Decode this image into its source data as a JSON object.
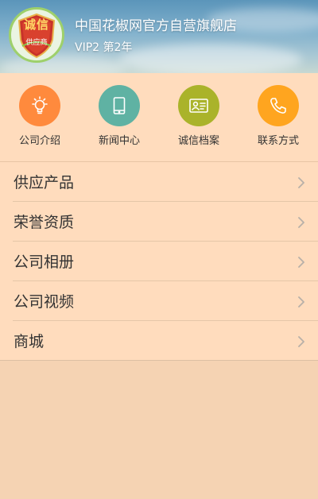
{
  "header": {
    "store_name": "中国花椒网官方自营旗舰店",
    "level": "VIP2 第2年",
    "avatar": {
      "badge_main": "诚信",
      "badge_sub": "供应商"
    }
  },
  "quick_links": [
    {
      "label": "公司介绍",
      "icon": "lightbulb-icon",
      "color": "#ff8a3d"
    },
    {
      "label": "新闻中心",
      "icon": "tablet-icon",
      "color": "#5fb2a3"
    },
    {
      "label": "诚信档案",
      "icon": "id-card-icon",
      "color": "#aab32a"
    },
    {
      "label": "联系方式",
      "icon": "phone-icon",
      "color": "#ffa51f"
    }
  ],
  "menu": [
    {
      "label": "供应产品"
    },
    {
      "label": "荣誉资质"
    },
    {
      "label": "公司相册"
    },
    {
      "label": "公司视频"
    },
    {
      "label": "商城"
    }
  ]
}
